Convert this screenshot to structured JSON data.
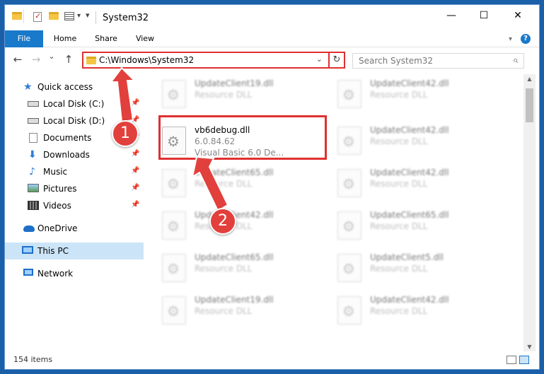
{
  "window": {
    "title": "System32"
  },
  "ribbon": {
    "tabs": [
      "File",
      "Home",
      "Share",
      "View"
    ],
    "help": "?"
  },
  "titlebar": {
    "minimize": "—",
    "maximize": "☐",
    "close": "✕",
    "dropdown": "▾"
  },
  "nav": {
    "back": "←",
    "forward": "→",
    "recent": "⌄",
    "up": "↑",
    "address": "C:\\Windows\\System32",
    "address_dropdown": "⌄",
    "refresh": "↻",
    "search_placeholder": "Search System32",
    "search_icon": "⌕"
  },
  "sidebar": {
    "pin_glyph": "📌",
    "items": [
      {
        "label": "Quick access",
        "icon": "star-icon"
      },
      {
        "label": "Local Disk (C:)",
        "icon": "drive-icon",
        "pinned": true
      },
      {
        "label": "Local Disk (D:)",
        "icon": "drive-icon",
        "pinned": true
      },
      {
        "label": "Documents",
        "icon": "documents-icon",
        "pinned": true
      },
      {
        "label": "Downloads",
        "icon": "downloads-icon",
        "pinned": true
      },
      {
        "label": "Music",
        "icon": "music-icon",
        "pinned": true
      },
      {
        "label": "Pictures",
        "icon": "pictures-icon",
        "pinned": true
      },
      {
        "label": "Videos",
        "icon": "videos-icon",
        "pinned": true
      },
      {
        "label": "OneDrive",
        "icon": "onedrive-icon"
      },
      {
        "label": "This PC",
        "icon": "pc-icon",
        "selected": true
      },
      {
        "label": "Network",
        "icon": "network-icon"
      }
    ]
  },
  "files": {
    "left_column": [
      {
        "name": "UpdateClient19.dll",
        "desc": "Resource DLL"
      },
      {
        "name": "vb6debug.dll",
        "version": "6.0.84.62",
        "desc": "Visual Basic 6.0 De..."
      },
      {
        "name": "UpdateClient65.dll",
        "desc": "Resource DLL"
      },
      {
        "name": "UpdateClient42.dll",
        "desc": "Resource DLL"
      },
      {
        "name": "UpdateClient65.dll",
        "desc": "Resource DLL"
      },
      {
        "name": "UpdateClient19.dll",
        "desc": "Resource DLL"
      }
    ],
    "right_column": [
      {
        "name": "UpdateClient42.dll",
        "desc": "Resource DLL"
      },
      {
        "name": "UpdateClient42.dll",
        "desc": "Resource DLL"
      },
      {
        "name": "UpdateClient42.dll",
        "desc": "Resource DLL"
      },
      {
        "name": "UpdateClient65.dll",
        "desc": "Resource DLL"
      },
      {
        "name": "UpdateClient5.dll",
        "desc": "Resource DLL"
      },
      {
        "name": "UpdateClient42.dll",
        "desc": "Resource DLL"
      }
    ]
  },
  "status": {
    "item_count": "154 items"
  },
  "annotations": {
    "step1": "1",
    "step2": "2"
  },
  "colors": {
    "accent": "#1979ca",
    "annotation_red": "#e2403c",
    "highlight": "#e03030"
  }
}
